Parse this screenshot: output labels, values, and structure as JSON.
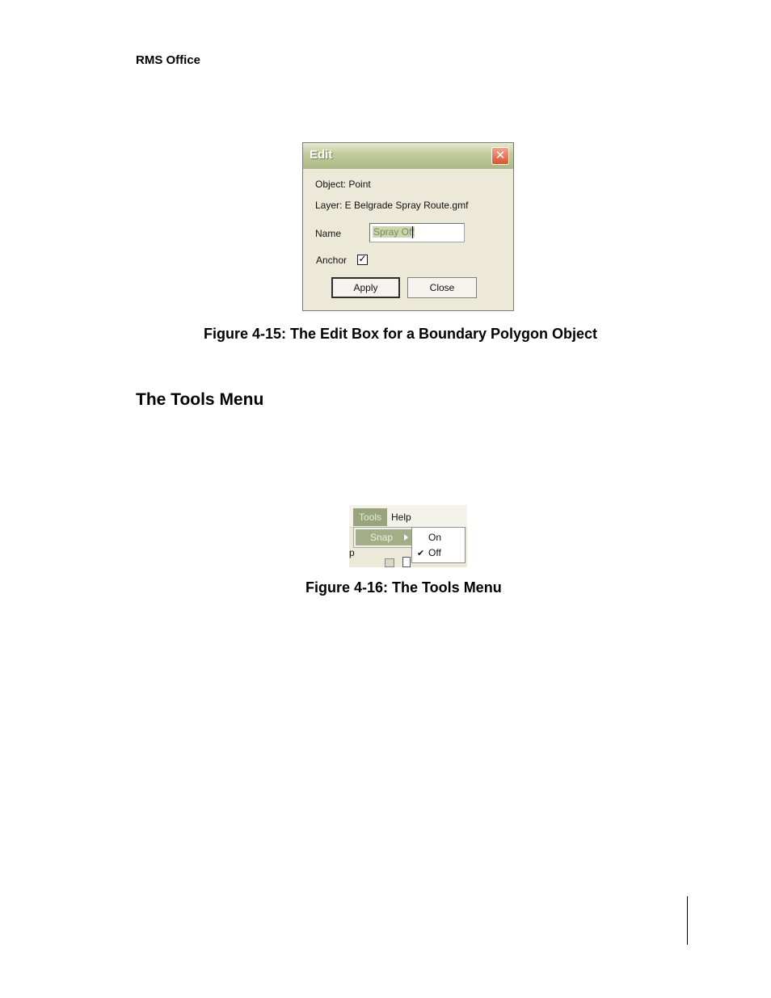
{
  "page": {
    "header": "RMS Office",
    "figure1_caption": "Figure 4-15: The Edit Box for a Boundary Polygon Object",
    "section_title": "The Tools Menu",
    "figure2_caption": "Figure 4-16: The Tools Menu"
  },
  "edit_dialog": {
    "title": "Edit",
    "close_icon": "close-icon",
    "close_glyph": "✕",
    "object_line": "Object: Point",
    "layer_line": "Layer: E Belgrade Spray Route.gmf",
    "name_label": "Name",
    "name_value": "Spray Off",
    "anchor_label": "Anchor",
    "anchor_checked": true,
    "check_glyph": "✓",
    "apply_label": "Apply",
    "close_label": "Close"
  },
  "tools_menu": {
    "menu_items": [
      "Tools",
      "Help"
    ],
    "dropdown_item": "Snap",
    "submenu_items": [
      "On",
      "Off"
    ],
    "selected": "Off",
    "check_glyph": "✔",
    "background_char": "p"
  },
  "colors": {
    "dialog_bg": "#ece9d8",
    "titlebar": "#aeb886",
    "close_button": "#d9552f",
    "menu_highlight": "#9aa47a"
  }
}
